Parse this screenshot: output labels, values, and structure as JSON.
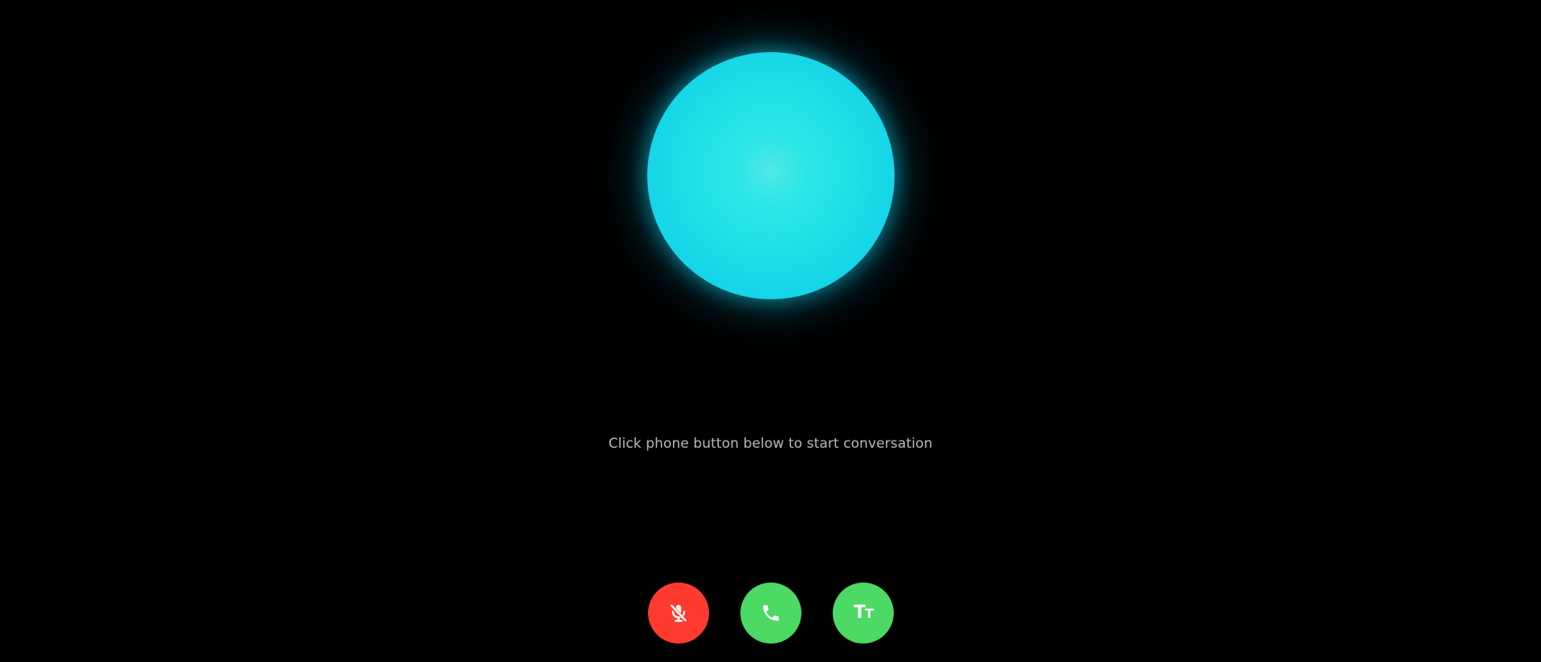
{
  "status": {
    "message": "Click phone button below to start conversation"
  },
  "orb": {
    "color": "#1fe0e6",
    "glow_color": "#14c8e6"
  },
  "controls": {
    "mute": {
      "icon": "mic-off-icon",
      "color": "#ff3b30"
    },
    "call": {
      "icon": "phone-icon",
      "color": "#4cd964"
    },
    "text_size": {
      "icon": "text-size-icon",
      "glyph_large": "T",
      "glyph_small": "T",
      "color": "#4cd964"
    }
  }
}
